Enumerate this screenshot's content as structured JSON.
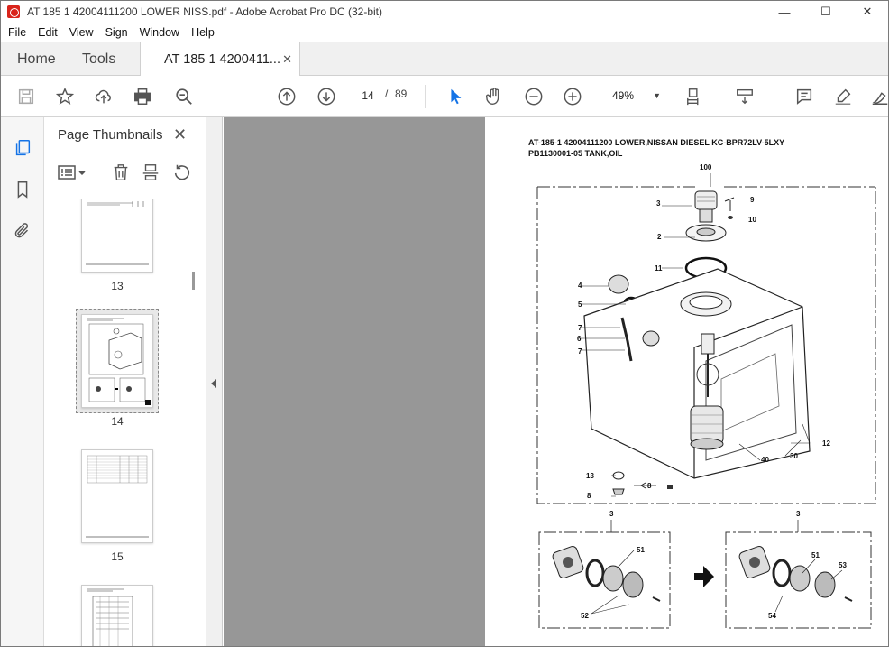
{
  "window": {
    "title": "AT 185 1 42004111200 LOWER NISS.pdf - Adobe Acrobat Pro DC (32-bit)",
    "minimize": "—",
    "maximize": "☐",
    "close": "✕"
  },
  "menu": [
    "File",
    "Edit",
    "View",
    "Sign",
    "Window",
    "Help"
  ],
  "tabs": {
    "home": "Home",
    "tools": "Tools",
    "document": "AT 185 1 4200411...",
    "document_close": "✕"
  },
  "toolbar": {
    "current_page": "14",
    "page_separator": "/",
    "total_pages": "89",
    "zoom": "49%",
    "icons": [
      "save-icon",
      "bookmark-star-icon",
      "upload-icon",
      "print-icon",
      "zoom-search-icon",
      "page-up-icon",
      "page-down-icon",
      "select-arrow-icon",
      "hand-icon",
      "zoom-out-icon",
      "zoom-in-icon",
      "fit-page-icon",
      "scroll-mode-icon",
      "comment-icon",
      "highlight-icon",
      "sign-icon"
    ]
  },
  "left_rail": {
    "icons": [
      "page-thumbnails-icon",
      "bookmarks-icon",
      "attachments-icon"
    ]
  },
  "thumbnail_panel": {
    "title": "Page Thumbnails",
    "close": "✕",
    "tools": [
      "options-icon",
      "delete-icon",
      "extract-icon",
      "rotate-icon"
    ],
    "thumbnails": [
      {
        "label": "13",
        "selected": false
      },
      {
        "label": "14",
        "selected": true
      },
      {
        "label": "15",
        "selected": false
      },
      {
        "label": "",
        "selected": false
      }
    ]
  },
  "document": {
    "heading_line1": "AT-185-1 42004111200 LOWER,NISSAN DIESEL KC-BPR72LV-5LXY",
    "heading_line2": "PB1130001-05 TANK,OIL",
    "callouts": [
      "100",
      "3",
      "9",
      "10",
      "2",
      "11",
      "4",
      "5",
      "7",
      "6",
      "7",
      "12",
      "30",
      "40",
      "13",
      "8",
      "8",
      "3",
      "3",
      "51",
      "52",
      "51",
      "53",
      "54"
    ]
  },
  "colors": {
    "accent": "#1473e6",
    "doc_background": "#979797",
    "title_icon": "#d9241b"
  }
}
